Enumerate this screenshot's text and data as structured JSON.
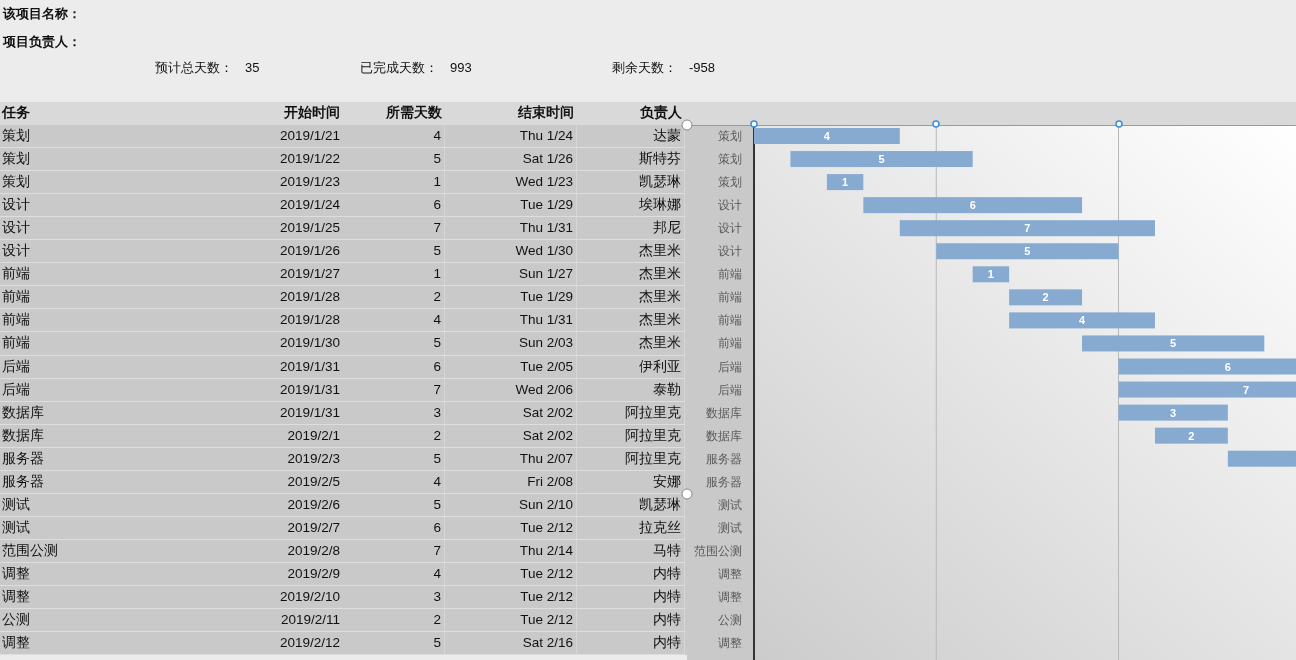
{
  "project": {
    "name_label": "该项目名称：",
    "owner_label": "项目负责人："
  },
  "stats": [
    {
      "label": "预计总天数：",
      "value": "35"
    },
    {
      "label": "已完成天数：",
      "value": "993"
    },
    {
      "label": "剩余天数：",
      "value": "-958"
    }
  ],
  "table": {
    "columns": [
      "任务",
      "开始时间",
      "所需天数",
      "结束时间",
      "负责人"
    ],
    "rows": [
      [
        "策划",
        "2019/1/21",
        "4",
        "Thu 1/24",
        "达蒙"
      ],
      [
        "策划",
        "2019/1/22",
        "5",
        "Sat 1/26",
        "斯特芬"
      ],
      [
        "策划",
        "2019/1/23",
        "1",
        "Wed 1/23",
        "凯瑟琳"
      ],
      [
        "设计",
        "2019/1/24",
        "6",
        "Tue 1/29",
        "埃琳娜"
      ],
      [
        "设计",
        "2019/1/25",
        "7",
        "Thu 1/31",
        "邦尼"
      ],
      [
        "设计",
        "2019/1/26",
        "5",
        "Wed 1/30",
        "杰里米"
      ],
      [
        "前端",
        "2019/1/27",
        "1",
        "Sun 1/27",
        "杰里米"
      ],
      [
        "前端",
        "2019/1/28",
        "2",
        "Tue 1/29",
        "杰里米"
      ],
      [
        "前端",
        "2019/1/28",
        "4",
        "Thu 1/31",
        "杰里米"
      ],
      [
        "前端",
        "2019/1/30",
        "5",
        "Sun 2/03",
        "杰里米"
      ],
      [
        "后端",
        "2019/1/31",
        "6",
        "Tue 2/05",
        "伊利亚"
      ],
      [
        "后端",
        "2019/1/31",
        "7",
        "Wed 2/06",
        "泰勒"
      ],
      [
        "数据库",
        "2019/1/31",
        "3",
        "Sat 2/02",
        "阿拉里克"
      ],
      [
        "数据库",
        "2019/2/1",
        "2",
        "Sat 2/02",
        "阿拉里克"
      ],
      [
        "服务器",
        "2019/2/3",
        "5",
        "Thu 2/07",
        "阿拉里克"
      ],
      [
        "服务器",
        "2019/2/5",
        "4",
        "Fri 2/08",
        "安娜"
      ],
      [
        "测试",
        "2019/2/6",
        "5",
        "Sun 2/10",
        "凯瑟琳"
      ],
      [
        "测试",
        "2019/2/7",
        "6",
        "Tue 2/12",
        "拉克丝"
      ],
      [
        "范围公测",
        "2019/2/8",
        "7",
        "Thu 2/14",
        "马特"
      ],
      [
        "调整",
        "2019/2/9",
        "4",
        "Tue 2/12",
        "内特"
      ],
      [
        "调整",
        "2019/2/10",
        "3",
        "Tue 2/12",
        "内特"
      ],
      [
        "公测",
        "2019/2/11",
        "2",
        "Tue 2/12",
        "内特"
      ],
      [
        "调整",
        "2019/2/12",
        "5",
        "Sat 2/16",
        "内特"
      ]
    ]
  },
  "gantt": {
    "rows": [
      {
        "label": "策划",
        "value": "4"
      },
      {
        "label": "策划",
        "value": "5"
      },
      {
        "label": "策划",
        "value": "1"
      },
      {
        "label": "设计",
        "value": "6"
      },
      {
        "label": "设计",
        "value": "7"
      },
      {
        "label": "设计",
        "value": "5"
      },
      {
        "label": "前端",
        "value": "1"
      },
      {
        "label": "前端",
        "value": "2"
      },
      {
        "label": "前端",
        "value": "4"
      },
      {
        "label": "前端",
        "value": "5"
      },
      {
        "label": "后端",
        "value": "6"
      },
      {
        "label": "后端",
        "value": "7"
      },
      {
        "label": "数据库",
        "value": "3"
      },
      {
        "label": "数据库",
        "value": "2"
      },
      {
        "label": "服务器"
      },
      {
        "label": "服务器"
      },
      {
        "label": "测试"
      },
      {
        "label": "测试"
      },
      {
        "label": "范围公测"
      },
      {
        "label": "调整"
      },
      {
        "label": "调整"
      },
      {
        "label": "公测"
      },
      {
        "label": "调整"
      }
    ]
  }
}
